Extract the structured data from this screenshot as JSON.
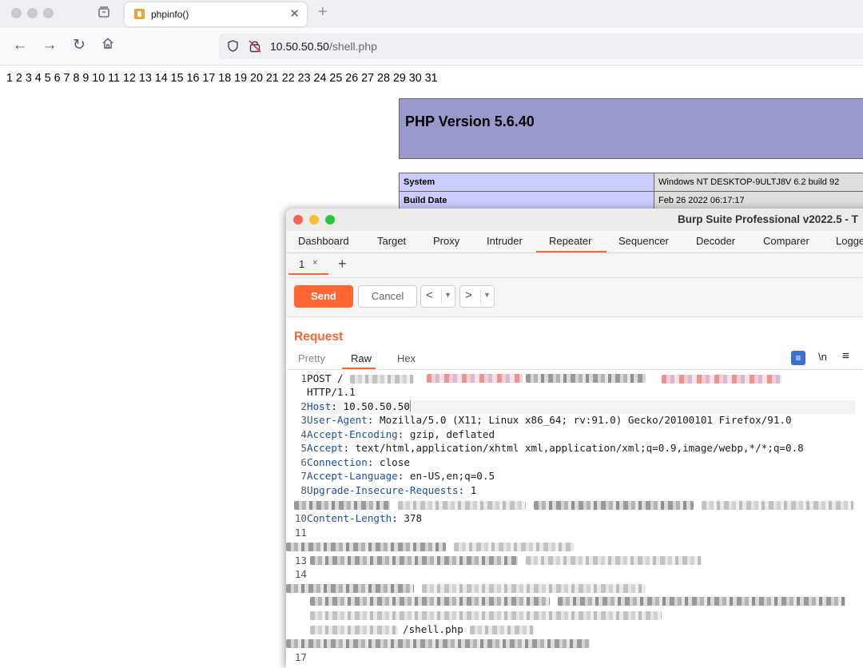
{
  "browser": {
    "tab_title": "phpinfo()",
    "tab_close": "✕",
    "new_tab": "+",
    "url_host": "10.50.50.50",
    "url_path": "/shell.php"
  },
  "page": {
    "numbers": "1 2 3 4 5 6 7 8 9 10 11 12 13 14 15 16 17 18 19 20 21 22 23 24 25 26 27 28 29 30 31",
    "php_version": "PHP Version 5.6.40",
    "info_rows": [
      {
        "key": "System",
        "value": "Windows NT DESKTOP-9ULTJ8V 6.2 build 92"
      },
      {
        "key": "Build Date",
        "value": "Feb 26 2022 06:17:17"
      }
    ]
  },
  "burp": {
    "title": "Burp Suite Professional v2022.5 - T",
    "menu": [
      "Dashboard",
      "Target",
      "Proxy",
      "Intruder",
      "Repeater",
      "Sequencer",
      "Decoder",
      "Comparer",
      "Logge"
    ],
    "active_menu": "Repeater",
    "subtab_label": "1",
    "subtab_close": "×",
    "subtab_add": "+",
    "send_label": "Send",
    "cancel_label": "Cancel",
    "back_arrow": "<",
    "forward_arrow": ">",
    "request_title": "Request",
    "view_tabs": [
      "Pretty",
      "Raw",
      "Hex"
    ],
    "active_view": "Raw",
    "newline_toggle": "\\n",
    "request_lines": [
      {
        "n": "1",
        "text": "POST /"
      },
      {
        "n": "",
        "text": "HTTP/1.1"
      },
      {
        "n": "2",
        "key": "Host",
        "value": ": 10.50.50.50"
      },
      {
        "n": "3",
        "key": "User-Agent",
        "value": ": Mozilla/5.0 (X11; Linux x86_64; rv:91.0) Gecko/20100101 Firefox/91.0"
      },
      {
        "n": "4",
        "key": "Accept-Encoding",
        "value": ": gzip, deflated"
      },
      {
        "n": "5",
        "key": "Accept",
        "value": ": text/html,application/xhtml xml,application/xml;q=0.9,image/webp,*/*;q=0.8"
      },
      {
        "n": "6",
        "key": "Connection",
        "value": ": close"
      },
      {
        "n": "7",
        "key": "Accept-Language",
        "value": ": en-US,en;q=0.5"
      },
      {
        "n": "8",
        "key": "Upgrade-Insecure-Requests",
        "value": ": 1"
      },
      {
        "n": "10",
        "key": "Content-Length",
        "value": ": 378"
      },
      {
        "n": "11",
        "text": ""
      },
      {
        "n": "13",
        "text": ""
      },
      {
        "n": "14",
        "text": ""
      },
      {
        "n": "",
        "text": "/shell.php"
      },
      {
        "n": "17",
        "text": ""
      }
    ]
  }
}
